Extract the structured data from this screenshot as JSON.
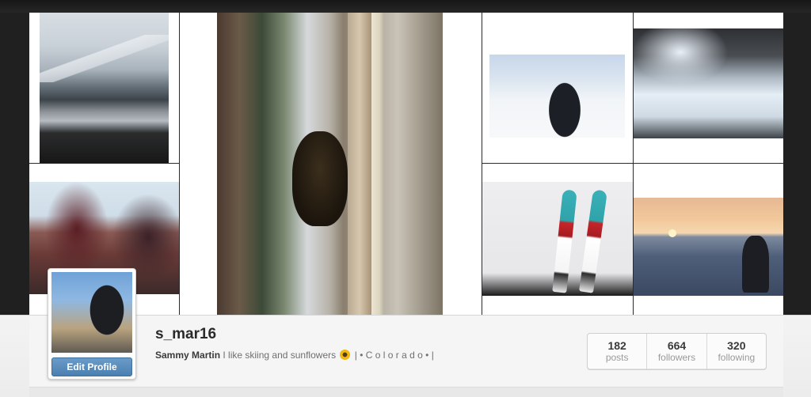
{
  "profile": {
    "username": "s_mar16",
    "full_name": "Sammy Martin",
    "bio_text": "I like skiing and sunflowers",
    "bio_emoji_icon": "sunflower-icon",
    "bio_suffix": "| • C o l o r a d o • |",
    "edit_button_label": "Edit Profile"
  },
  "stats": [
    {
      "value": "182",
      "label": "posts"
    },
    {
      "value": "664",
      "label": "followers"
    },
    {
      "value": "320",
      "label": "following"
    }
  ],
  "colors": {
    "edit_button": "#4a7fb0",
    "page_dark": "#1e1e1e",
    "profile_bg": "#f5f5f5"
  }
}
